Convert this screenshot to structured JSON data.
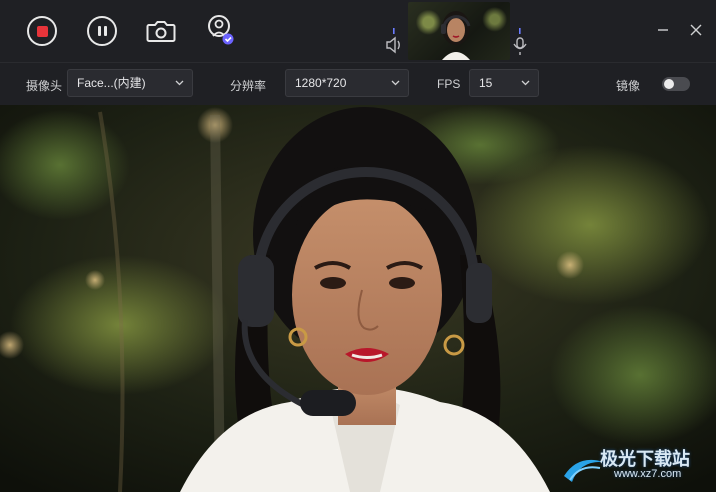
{
  "toolbar": {
    "record_icon": "record-stop-icon",
    "pause_icon": "pause-icon",
    "snapshot_icon": "camera-icon",
    "avatar_icon": "avatar-check-icon",
    "speaker_icon": "speaker-icon",
    "mic_icon": "microphone-icon",
    "record_color": "#e8343a",
    "accent_color": "#6c63ff"
  },
  "window": {
    "minimize_icon": "minimize-icon",
    "close_icon": "close-icon"
  },
  "settings": {
    "camera_label": "摄像头",
    "camera_value": "Face...(内建)",
    "resolution_label": "分辨率",
    "resolution_value": "1280*720",
    "fps_label": "FPS",
    "fps_value": "15",
    "mirror_label": "镜像",
    "mirror_on": false
  },
  "watermark": {
    "text": "极光下载站",
    "url": "www.xz7.com"
  }
}
